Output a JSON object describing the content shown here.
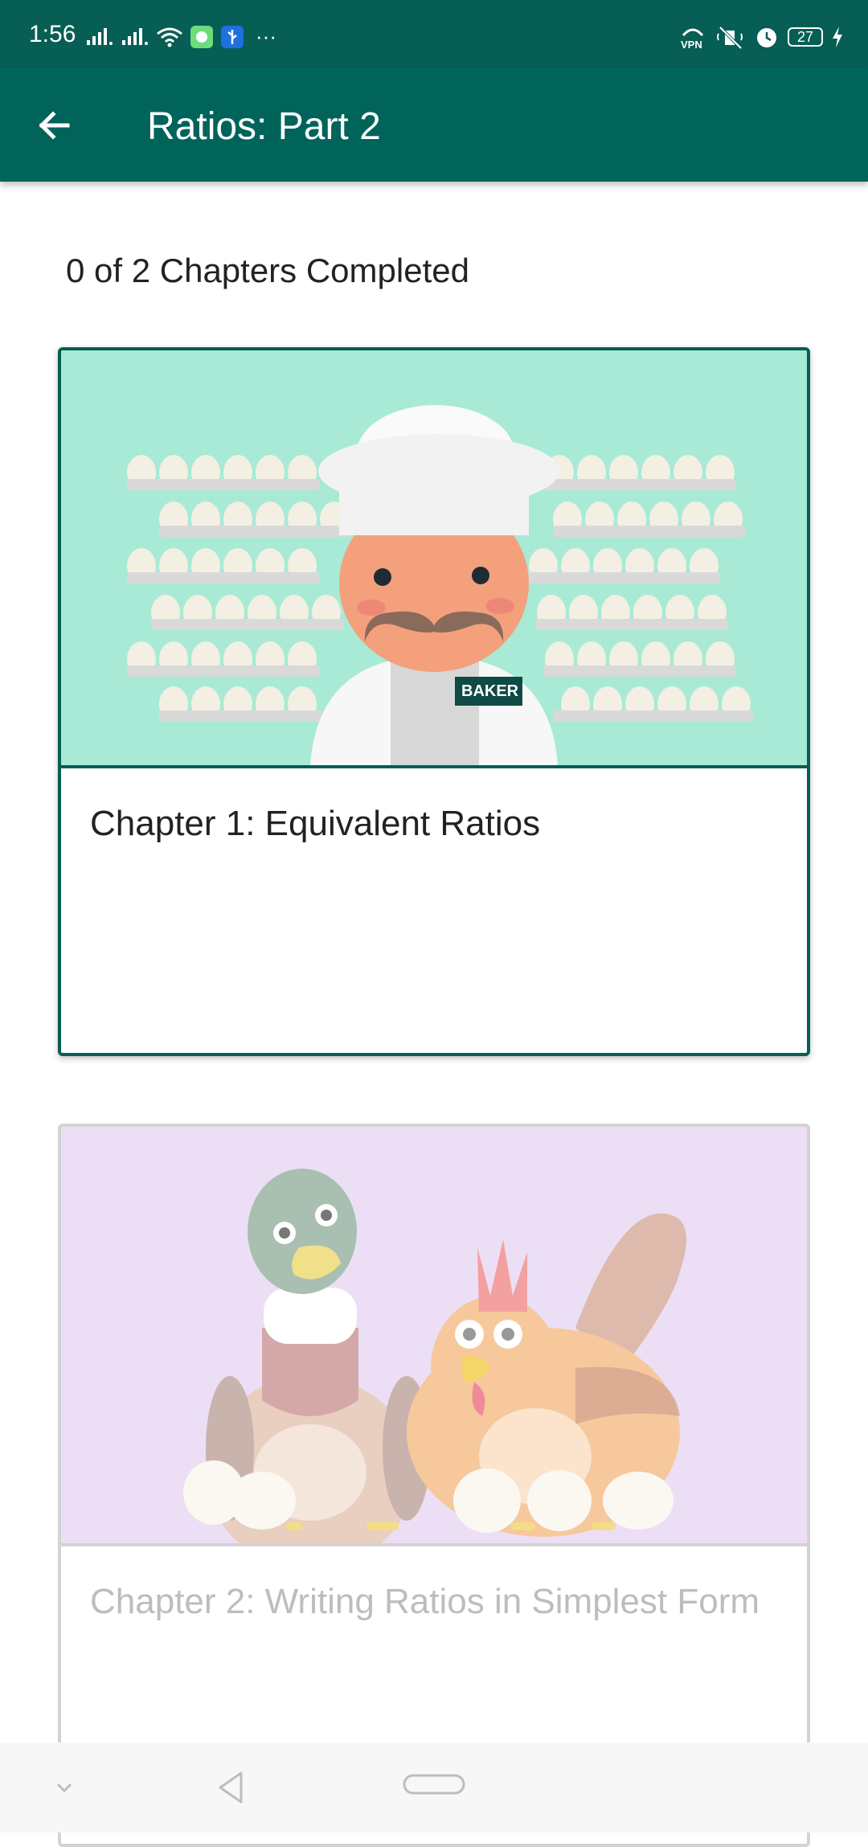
{
  "status_bar": {
    "time": "1:56",
    "more_dots": "···",
    "battery_level": "27",
    "icons": [
      "signal-icon",
      "signal-icon",
      "wifi-icon",
      "notification-app-icon",
      "usb-icon",
      "vpn-icon",
      "mute-icon",
      "alarm-icon",
      "battery-icon",
      "charging-icon"
    ]
  },
  "app_bar": {
    "title": "Ratios: Part 2",
    "back_icon": "arrow-left-icon",
    "background": "#00645a"
  },
  "progress": {
    "text": "0 of 2 Chapters Completed"
  },
  "chapters": [
    {
      "title": "Chapter 1: Equivalent Ratios",
      "image": "baker-with-eggs-illustration",
      "badge_text": "BAKER",
      "image_bg": "#a8ead5",
      "border_color": "#075e54",
      "enabled": true
    },
    {
      "title": "Chapter 2: Writing Ratios in Simplest Form",
      "image": "duck-and-chicken-illustration",
      "image_bg": "#ecdff5",
      "border_color": "#d3d3d3",
      "enabled": false
    }
  ],
  "nav_bar": {
    "icons": [
      "chevron-down-icon",
      "back-triangle-icon",
      "home-pill-icon"
    ]
  },
  "colors": {
    "status_bar": "#075e54",
    "accent": "#00645a",
    "disabled_text": "#bdbdbd"
  }
}
